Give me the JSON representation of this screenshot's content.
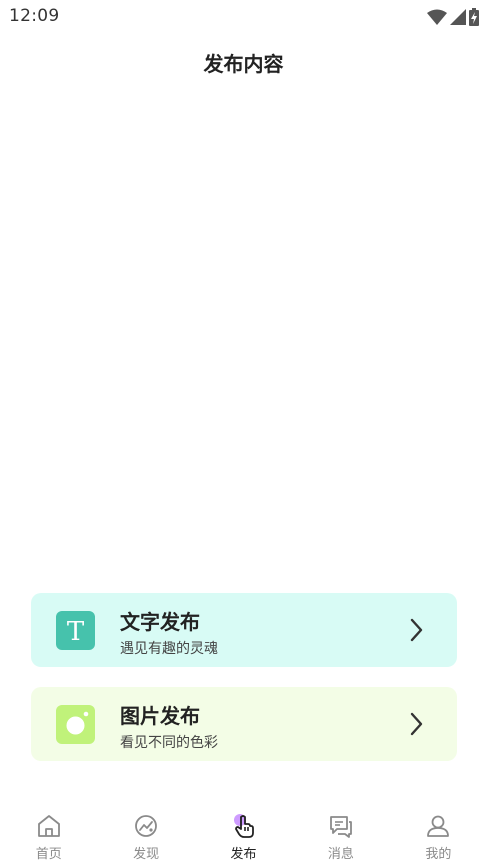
{
  "status_bar": {
    "time": "12:09",
    "icons": [
      "wifi-icon",
      "signal-icon",
      "battery-charging-icon"
    ]
  },
  "header": {
    "title": "发布内容"
  },
  "options": [
    {
      "title": "文字发布",
      "subtitle": "遇见有趣的灵魂",
      "icon": "text-t-icon",
      "icon_letter": "T",
      "bg_color": "#d8fbf5",
      "icon_color": "#46c2ac"
    },
    {
      "title": "图片发布",
      "subtitle": "看见不同的色彩",
      "icon": "camera-icon",
      "bg_color": "#f3fde6",
      "icon_color": "#c0f27a"
    }
  ],
  "bottom_nav": {
    "items": [
      {
        "label": "首页",
        "icon": "home-icon"
      },
      {
        "label": "发现",
        "icon": "discover-icon"
      },
      {
        "label": "发布",
        "icon": "publish-touch-icon",
        "active": true
      },
      {
        "label": "消息",
        "icon": "message-icon"
      },
      {
        "label": "我的",
        "icon": "user-icon"
      }
    ],
    "active_color": "#222222",
    "inactive_color": "#8a8a8a"
  }
}
